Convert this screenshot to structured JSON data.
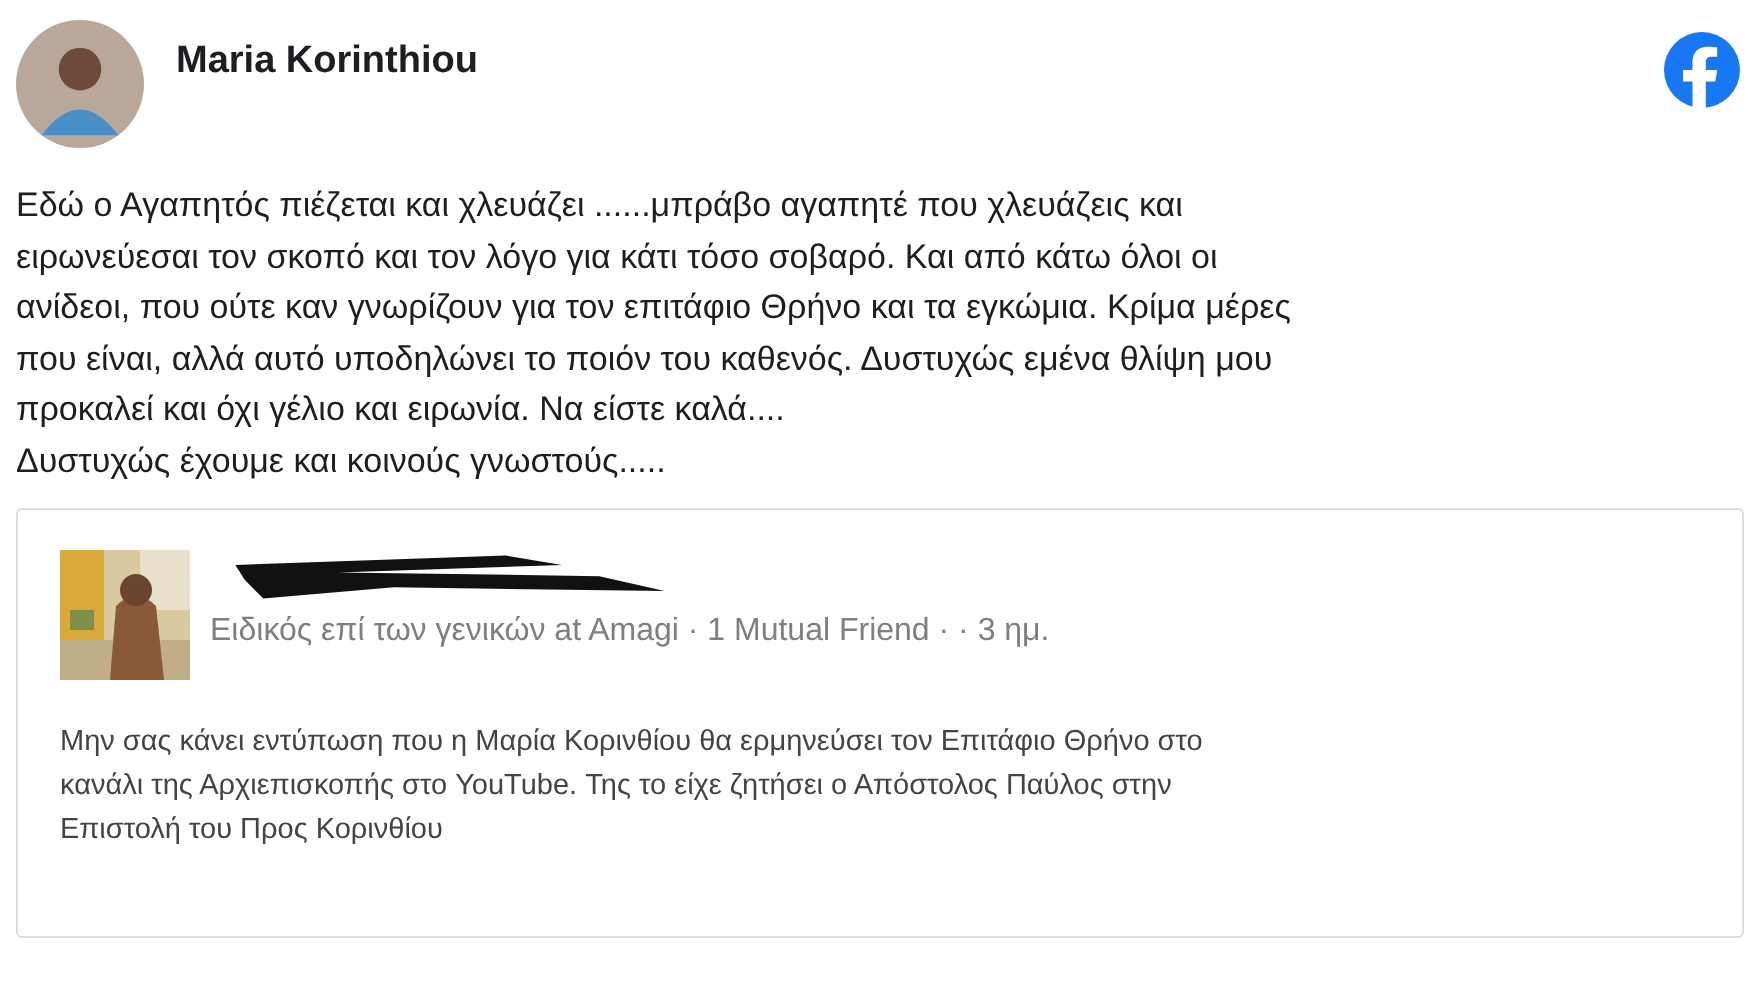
{
  "author": {
    "name": "Maria Korinthiou"
  },
  "post": {
    "lines": [
      "Εδώ ο Αγαπητός πιέζεται και χλευάζει ......μπράβο αγαπητέ που χλευάζεις και",
      "ειρωνεύεσαι τον σκοπό και τον λόγο για κάτι τόσο σοβαρό. Και από κάτω όλοι οι",
      "ανίδεοι, που ούτε καν γνωρίζουν για τον επιτάφιο Θρήνο και τα εγκώμια. Κρίμα μέρες",
      "που είναι, αλλά αυτό υποδηλώνει το ποιόν του καθενός. Δυστυχώς εμένα θλίψη μου",
      "προκαλεί και όχι γέλιο και ειρωνία. Να είστε καλά....",
      "Δυστυχώς έχουμε και κοινούς γνωστούς....."
    ]
  },
  "quoted_comment": {
    "author_redacted": true,
    "subtitle": "Ειδικός επί των γενικών at Amagi · 1 Mutual Friend · · 3 ημ.",
    "lines": [
      "Μην σας κάνει εντύπωση που η Μαρία Κορινθίου θα ερμηνεύσει τον Επιτάφιο Θρήνο στο",
      "κανάλι της Αρχιεπισκοπής στο YouTube. Της το είχε ζητήσει ο Απόστολος Παύλος στην",
      "Επιστολή του Προς Κορινθίου"
    ]
  }
}
